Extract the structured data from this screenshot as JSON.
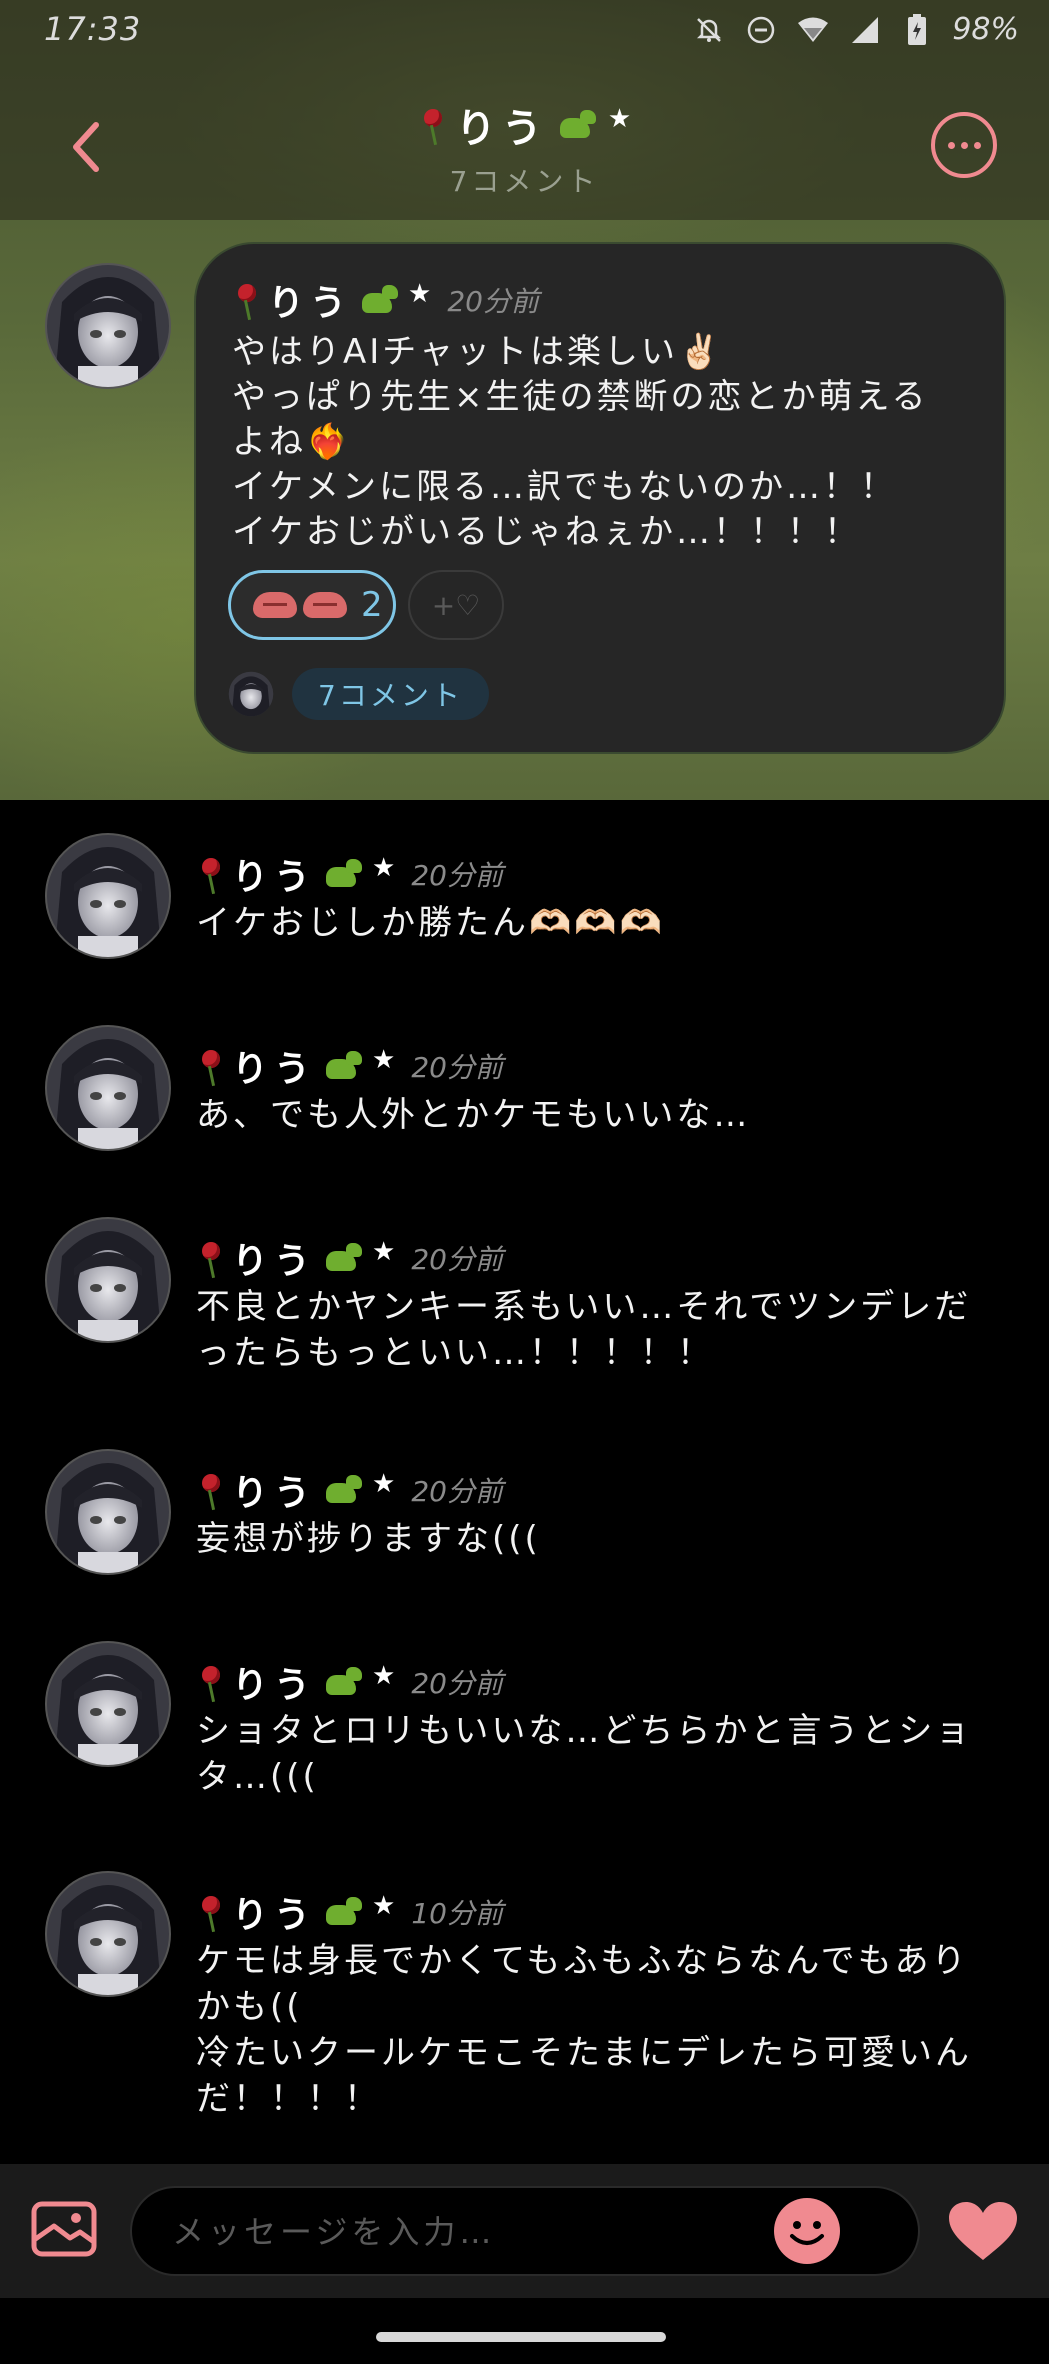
{
  "status_bar": {
    "time": "17:33",
    "battery": "98%",
    "icons": [
      "bell-off-icon",
      "dnd-icon",
      "wifi-icon",
      "signal-icon",
      "battery-icon"
    ]
  },
  "header": {
    "title": "りう",
    "subtitle": "7コメント",
    "back_icon": "chevron-left-icon",
    "more_icon": "more-icon",
    "accent_color": "#f08a90"
  },
  "post": {
    "author": "りう",
    "time": "20分前",
    "lines": [
      "やはりAIチャットは楽しい✌🏻",
      "やっぱり先生×生徒の禁断の恋とか萌える",
      "よね❤️‍🔥",
      "イケメンに限る…訳でもないのか…！！",
      "イケおじがいるじゃねぇか…！！！！"
    ],
    "reaction_count": "2",
    "add_reaction_label": "+♡",
    "comment_chip": "7コメント"
  },
  "comments": [
    {
      "author": "りう",
      "time": "20分前",
      "lines": [
        "イケおじしか勝たん🫶🏻🫶🏻🫶🏻"
      ]
    },
    {
      "author": "りう",
      "time": "20分前",
      "lines": [
        "あ、でも人外とかケモもいいな…"
      ]
    },
    {
      "author": "りう",
      "time": "20分前",
      "lines": [
        "不良とかヤンキー系もいい…それでツンデレだ",
        "ったらもっといい…！！！！！"
      ]
    },
    {
      "author": "りう",
      "time": "20分前",
      "lines": [
        "妄想が捗りますな((("
      ]
    },
    {
      "author": "りう",
      "time": "20分前",
      "lines": [
        "ショタとロリもいいな…どちらかと言うとショ",
        "タ…((("
      ]
    },
    {
      "author": "りう",
      "time": "10分前",
      "lines": [
        "ケモは身長でかくてもふもふならなんでもあり",
        "かも((",
        "冷たいクールケモこそたまにデレたら可愛いん",
        "だ！！！！"
      ]
    }
  ],
  "input": {
    "placeholder": "メッセージを入力…"
  }
}
